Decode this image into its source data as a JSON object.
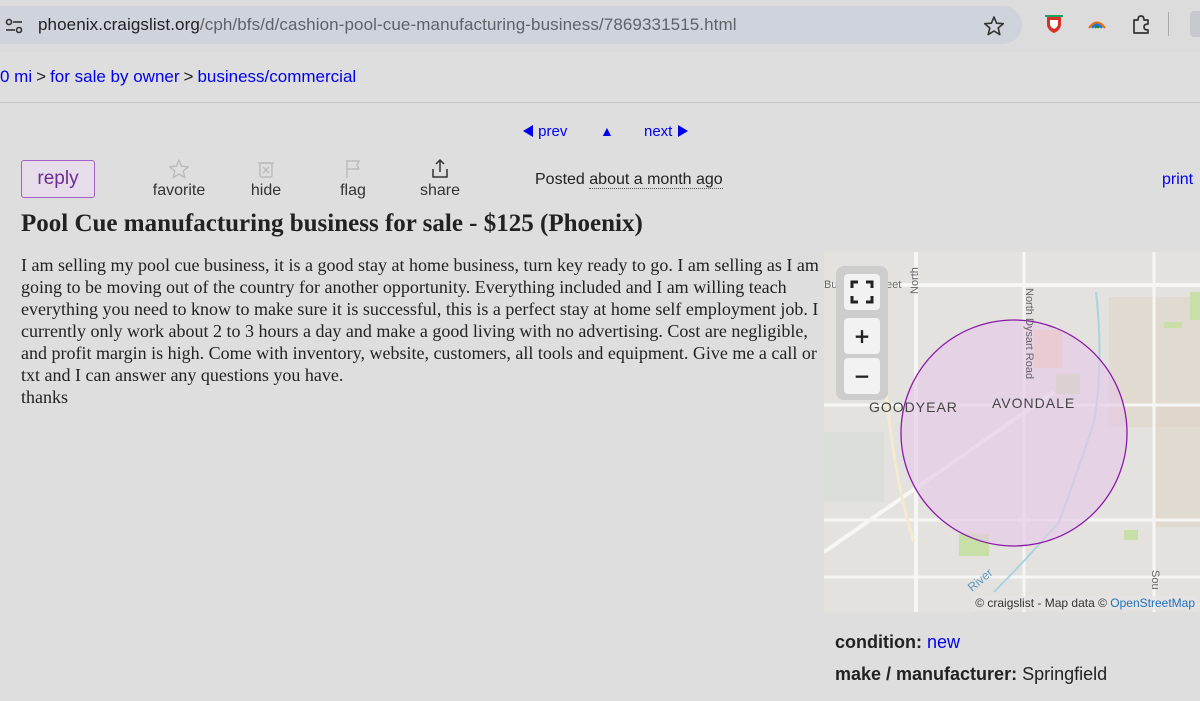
{
  "browser": {
    "url_host": "phoenix.craigslist.org",
    "url_path": "/cph/bfs/d/cashion-pool-cue-manufacturing-business/7869331515.html"
  },
  "breadcrumb": {
    "items": [
      "0 mi",
      "for sale by owner",
      "business/commercial"
    ],
    "separator": ">"
  },
  "pager": {
    "prev": "prev",
    "up": "▲",
    "next": "next"
  },
  "actions": {
    "reply": "reply",
    "favorite": "favorite",
    "hide": "hide",
    "flag": "flag",
    "share": "share",
    "posted_label": "Posted",
    "posted_when": "about a month ago",
    "print": "print"
  },
  "posting": {
    "title": "Pool Cue manufacturing business for sale - $125 (Phoenix)",
    "body_line": "I am selling my pool cue business, it is a good stay at home business, turn key ready to go. I am selling as I am going to be moving out of the country for another opportunity. Everything included and I am willing teach everything you need to know to make sure it is successful, this is a perfect stay at home self employment job. I currently only work about 2 to 3 hours a day and make a good living with no advertising. Cost are negligible, and profit margin is high. Come with inventory, website, customers, all tools and equipment. Give me a call or txt and I can answer any questions you have.",
    "body_thanks": "thanks"
  },
  "map": {
    "labels": {
      "goodyear": "GOODYEAR",
      "avondale": "AVONDALE",
      "dysart": "North Dysart Road",
      "north": "North",
      "bun": "Bun",
      "eet": "eet",
      "river": "River",
      "sou": "Sou"
    },
    "controls": {
      "fullscreen": "⛶",
      "zoom_in": "+",
      "zoom_out": "−"
    },
    "credit_prefix": "© craigslist - Map data ©",
    "credit_link": "OpenStreetMap",
    "circle_color": "#8a1aa8",
    "circle_fill": "#e7c9e6"
  },
  "attributes": [
    {
      "label": "condition:",
      "value": "new"
    },
    {
      "label": "make / manufacturer:",
      "value": "Springfield"
    }
  ],
  "colors": {
    "link": "#0000ee",
    "reply_border": "#a560c8",
    "page_bg": "#dedede"
  }
}
